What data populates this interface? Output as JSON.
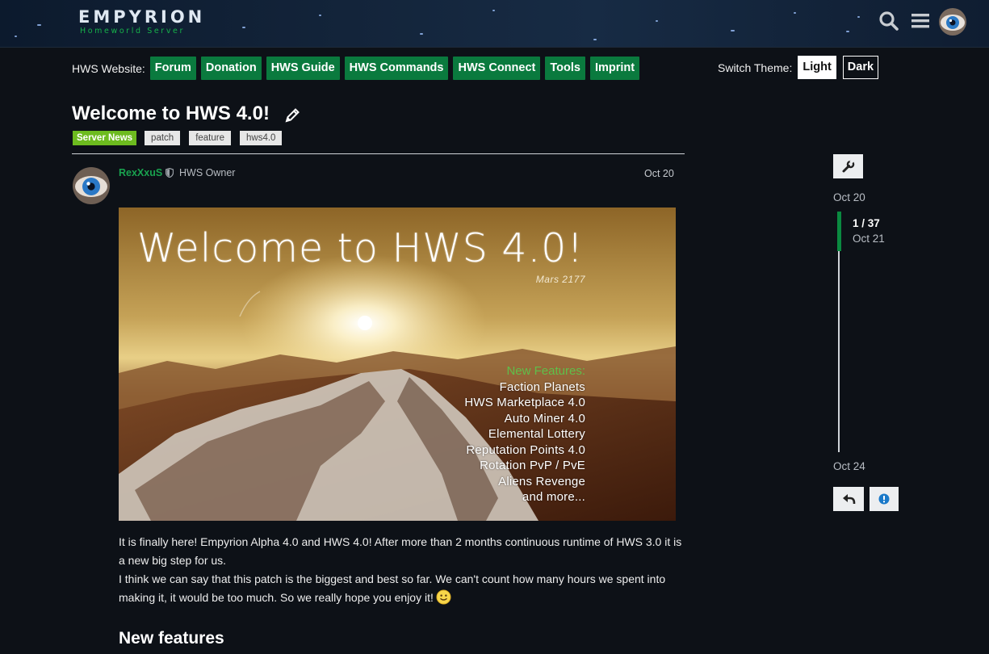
{
  "header": {
    "logo_text": "EMPYRION",
    "logo_subtext": "Homeworld Server",
    "icons": [
      "search-icon",
      "hamburger-menu-icon",
      "user-avatar"
    ]
  },
  "nav": {
    "label": "HWS Website:",
    "links": [
      "Forum",
      "Donation",
      "HWS Guide",
      "HWS Commands",
      "HWS Connect",
      "Tools",
      "Imprint"
    ],
    "theme_label": "Switch Theme:",
    "theme_light": "Light",
    "theme_dark": "Dark"
  },
  "topic": {
    "title": "Welcome to HWS 4.0!",
    "category": "Server News",
    "tags": [
      "patch",
      "feature",
      "hws4.0"
    ]
  },
  "post": {
    "username": "RexXxuS",
    "user_title": "HWS Owner",
    "date": "Oct 20",
    "banner": {
      "title": "Welcome to HWS 4.0!",
      "subtitle": "Mars 2177",
      "features_heading": "New Features:",
      "features": [
        "Faction Planets",
        "HWS Marketplace 4.0",
        "Auto Miner 4.0",
        "Elemental Lottery",
        "Reputation Points 4.0",
        "Rotation PvP / PvE",
        "Aliens Revenge",
        "and more..."
      ]
    },
    "paragraph_1": "It is finally here! Empyrion Alpha 4.0 and HWS 4.0! After more than 2 months continuous runtime of HWS 3.0 it is a new big step for us.",
    "paragraph_2": "I think we can say that this patch is the biggest and best so far. We can't count how many hours we spent into making it, it would be too much. So we really hope you enjoy it!",
    "section_heading": "New features"
  },
  "timeline": {
    "start_date": "Oct 20",
    "position": "1 / 37",
    "position_date": "Oct 21",
    "end_date": "Oct 24",
    "progress_fraction": 0.027
  },
  "colors": {
    "background": "#0d1117",
    "nav_button": "#0a7a3e",
    "category_tag": "#6dbb1f",
    "username": "#19a34f"
  }
}
